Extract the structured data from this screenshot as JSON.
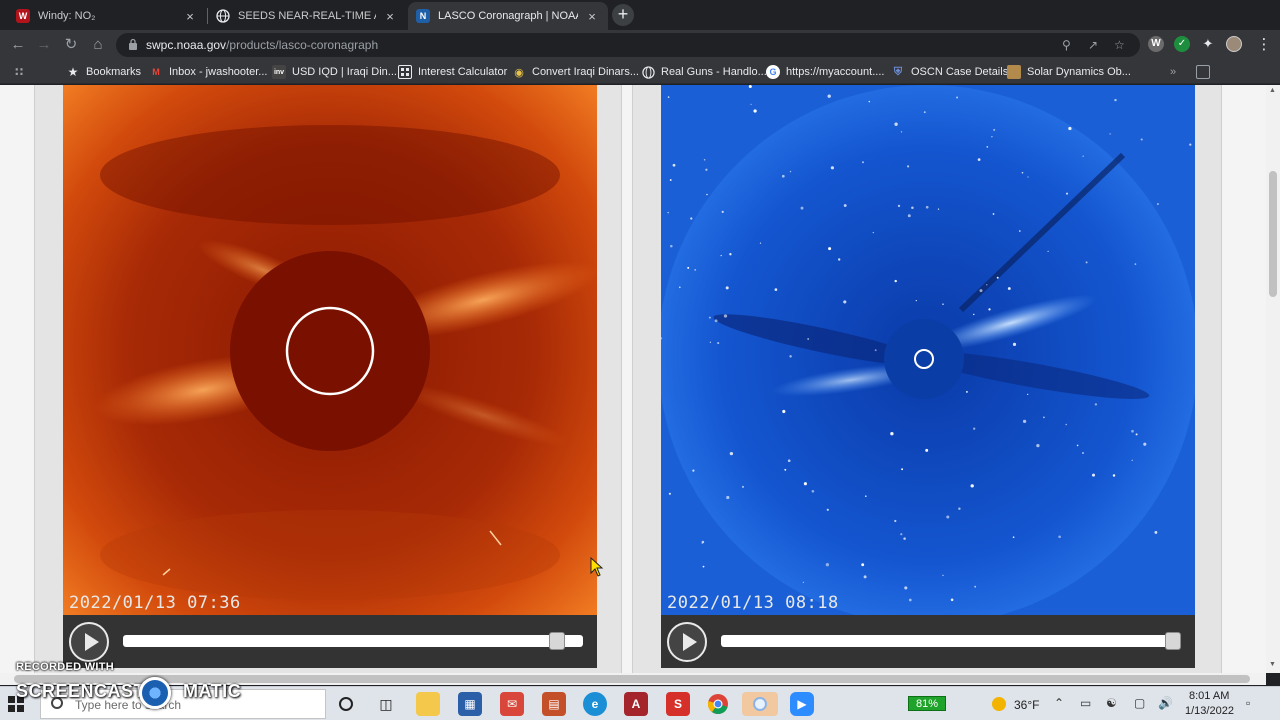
{
  "tabs": [
    {
      "title": "Windy: NO₂",
      "icon": "windy-icon",
      "active": false
    },
    {
      "title": "SEEDS NEAR-REAL-TIME AND BE",
      "icon": "globe-icon",
      "active": false
    },
    {
      "title": "LASCO Coronagraph | NOAA / N",
      "icon": "noaa-icon",
      "active": true
    }
  ],
  "tab_close_glyph": "×",
  "new_tab_glyph": "+",
  "address": {
    "host": "swpc.noaa.gov",
    "path": "/products/lasco-coronagraph"
  },
  "bookmarks": [
    {
      "label": "Bookmarks",
      "icon": "star-icon"
    },
    {
      "label": "Inbox - jwashooter...",
      "icon": "gmail-icon"
    },
    {
      "label": "USD IQD | Iraqi Din...",
      "icon": "inv-icon"
    },
    {
      "label": "Interest Calculator",
      "icon": "calculator-icon"
    },
    {
      "label": "Convert Iraqi Dinars...",
      "icon": "coins-icon"
    },
    {
      "label": "Real Guns - Handlo...",
      "icon": "globe-icon"
    },
    {
      "label": "https://myaccount....",
      "icon": "google-icon"
    },
    {
      "label": "OSCN Case Details",
      "icon": "shield-icon"
    },
    {
      "label": "Solar Dynamics Ob...",
      "icon": "sdo-icon"
    }
  ],
  "viewers": [
    {
      "name": "c2",
      "timestamp": "2022/01/13 07:36",
      "progress": 0.96
    },
    {
      "name": "c3",
      "timestamp": "2022/01/13 08:18",
      "progress": 1.0
    }
  ],
  "taskbar": {
    "search_placeholder": "Type here to search",
    "battery": "81%",
    "temperature": "36°F",
    "time": "8:01 AM",
    "date": "1/13/2022"
  },
  "watermark": {
    "top": "RECORDED WITH",
    "main_left": "SCREENCAST",
    "main_right": "MATIC"
  },
  "colors": {
    "c2_core": "#7a1000",
    "c2_rim": "#e8500e",
    "c3_core": "#0a3aa8",
    "c3_rim": "#2d7ff0",
    "tab_active": "#35363a"
  }
}
